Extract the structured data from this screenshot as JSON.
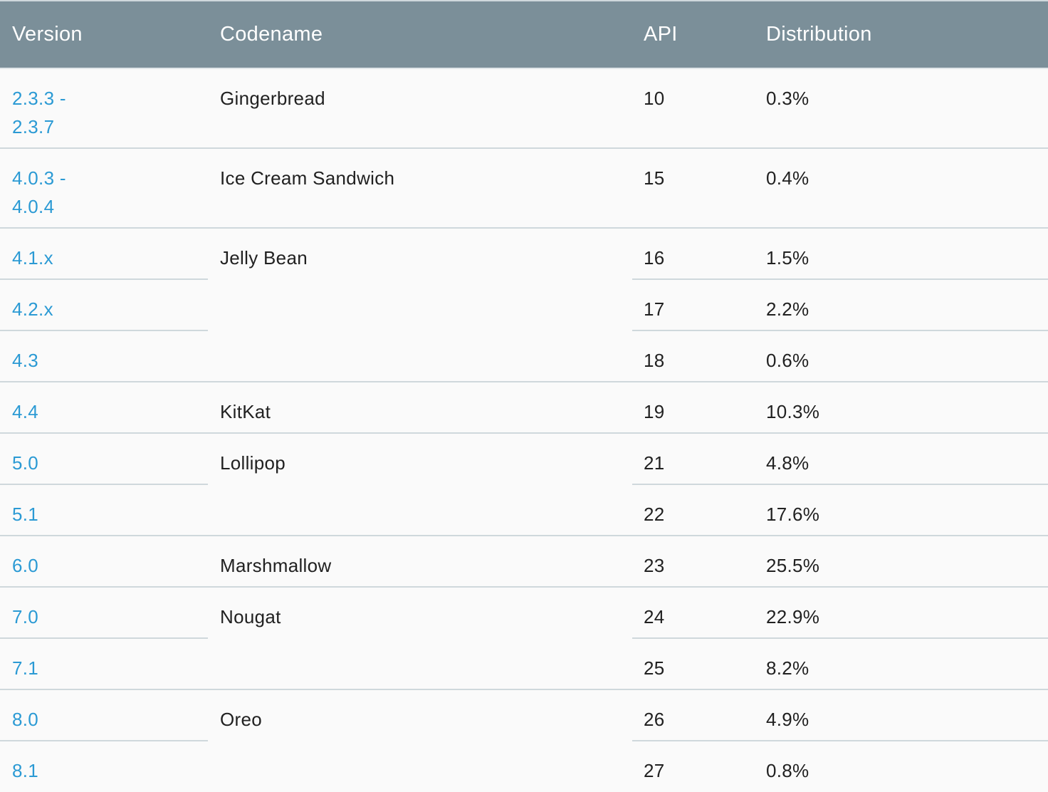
{
  "table": {
    "headers": {
      "version": "Version",
      "codename": "Codename",
      "api": "API",
      "distribution": "Distribution"
    },
    "rows": [
      {
        "version": "2.3.3 - 2.3.7",
        "codename": "Gingerbread",
        "api": "10",
        "distribution": "0.3%"
      },
      {
        "version": "4.0.3 - 4.0.4",
        "codename": "Ice Cream Sandwich",
        "api": "15",
        "distribution": "0.4%"
      },
      {
        "version": "4.1.x",
        "codename": "Jelly Bean",
        "api": "16",
        "distribution": "1.5%"
      },
      {
        "version": "4.2.x",
        "codename": "",
        "api": "17",
        "distribution": "2.2%"
      },
      {
        "version": "4.3",
        "codename": "",
        "api": "18",
        "distribution": "0.6%"
      },
      {
        "version": "4.4",
        "codename": "KitKat",
        "api": "19",
        "distribution": "10.3%"
      },
      {
        "version": "5.0",
        "codename": "Lollipop",
        "api": "21",
        "distribution": "4.8%"
      },
      {
        "version": "5.1",
        "codename": "",
        "api": "22",
        "distribution": "17.6%"
      },
      {
        "version": "6.0",
        "codename": "Marshmallow",
        "api": "23",
        "distribution": "25.5%"
      },
      {
        "version": "7.0",
        "codename": "Nougat",
        "api": "24",
        "distribution": "22.9%"
      },
      {
        "version": "7.1",
        "codename": "",
        "api": "25",
        "distribution": "8.2%"
      },
      {
        "version": "8.0",
        "codename": "Oreo",
        "api": "26",
        "distribution": "4.9%"
      },
      {
        "version": "8.1",
        "codename": "",
        "api": "27",
        "distribution": "0.8%"
      }
    ]
  },
  "colors": {
    "header_bg": "#7b8f99",
    "link": "#2b9ad4",
    "border": "#cfd8dc"
  }
}
